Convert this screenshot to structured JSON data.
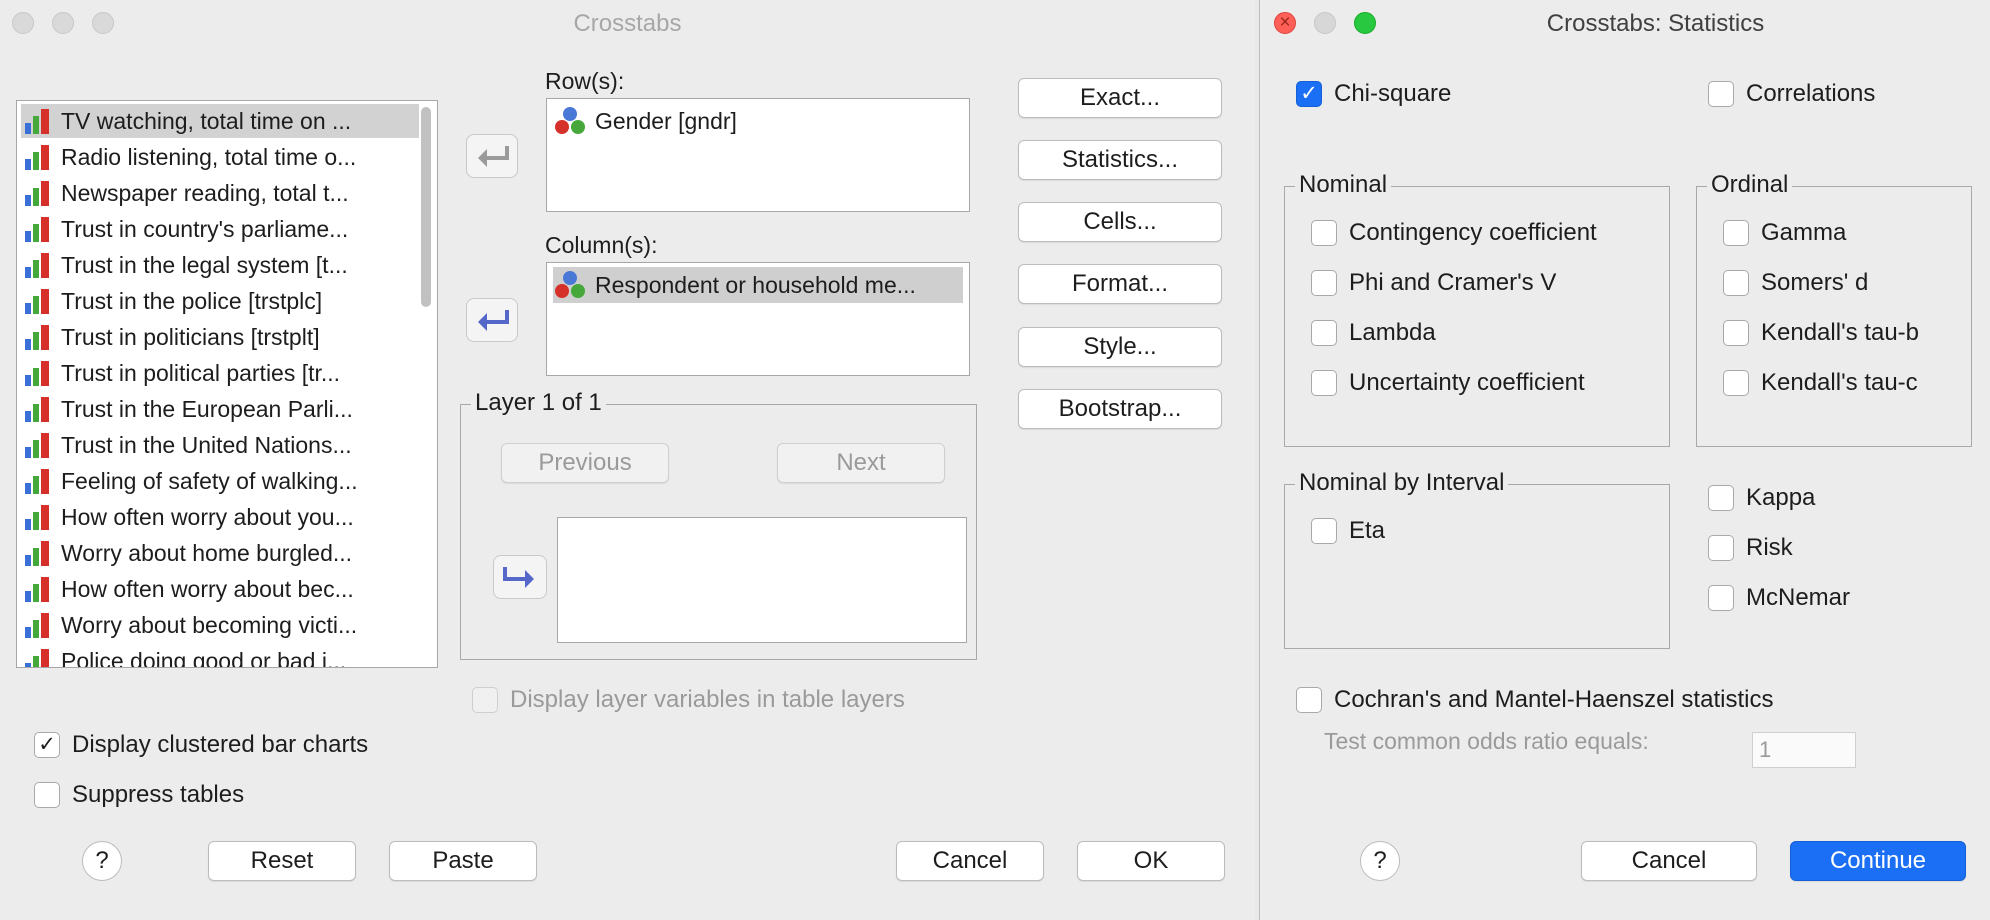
{
  "crosstabs": {
    "title": "Crosstabs",
    "variables": [
      "TV watching, total time on ...",
      "Radio listening, total time o...",
      "Newspaper reading, total t...",
      "Trust in country's parliame...",
      "Trust in the legal system [t...",
      "Trust in the police [trstplc]",
      "Trust in politicians [trstplt]",
      "Trust in political parties [tr...",
      "Trust in the European Parli...",
      "Trust in the United Nations...",
      "Feeling of safety of walking...",
      "How often worry about you...",
      "Worry about home burgled...",
      "How often worry about bec...",
      "Worry about becoming victi...",
      "Police doing good or bad j..."
    ],
    "rows_label": "Row(s):",
    "rows_items": [
      "Gender [gndr]"
    ],
    "columns_label": "Column(s):",
    "columns_items": [
      "Respondent or household me..."
    ],
    "layer": {
      "title": "Layer 1 of 1",
      "previous_label": "Previous",
      "next_label": "Next"
    },
    "display_layer_label": "Display layer variables in table layers",
    "display_clustered_label": "Display clustered bar charts",
    "suppress_tables_label": "Suppress tables",
    "side_buttons": {
      "exact": "Exact...",
      "statistics": "Statistics...",
      "cells": "Cells...",
      "format": "Format...",
      "style": "Style...",
      "bootstrap": "Bootstrap..."
    },
    "footer": {
      "help": "?",
      "reset": "Reset",
      "paste": "Paste",
      "cancel": "Cancel",
      "ok": "OK"
    }
  },
  "statistics": {
    "title": "Crosstabs: Statistics",
    "chi_square": "Chi-square",
    "correlations": "Correlations",
    "nominal": {
      "title": "Nominal",
      "items": [
        "Contingency coefficient",
        "Phi and Cramer's V",
        "Lambda",
        "Uncertainty coefficient"
      ]
    },
    "ordinal": {
      "title": "Ordinal",
      "items": [
        "Gamma",
        "Somers' d",
        "Kendall's tau-b",
        "Kendall's tau-c"
      ]
    },
    "nominal_interval": {
      "title": "Nominal by Interval",
      "items": [
        "Eta"
      ]
    },
    "other": [
      "Kappa",
      "Risk",
      "McNemar"
    ],
    "cochran": "Cochran's and Mantel-Haenszel statistics",
    "odds_label": "Test common odds ratio equals:",
    "odds_value": "1",
    "footer": {
      "help": "?",
      "cancel": "Cancel",
      "continue": "Continue"
    }
  },
  "colors": {
    "accent": "#1a6ff4",
    "close": "#fe5f57",
    "zoom": "#28c840"
  },
  "icons": {
    "variable": "ordinal-scale-icon",
    "nominal": "nominal-scale-icon",
    "move": "arrow-icon"
  }
}
